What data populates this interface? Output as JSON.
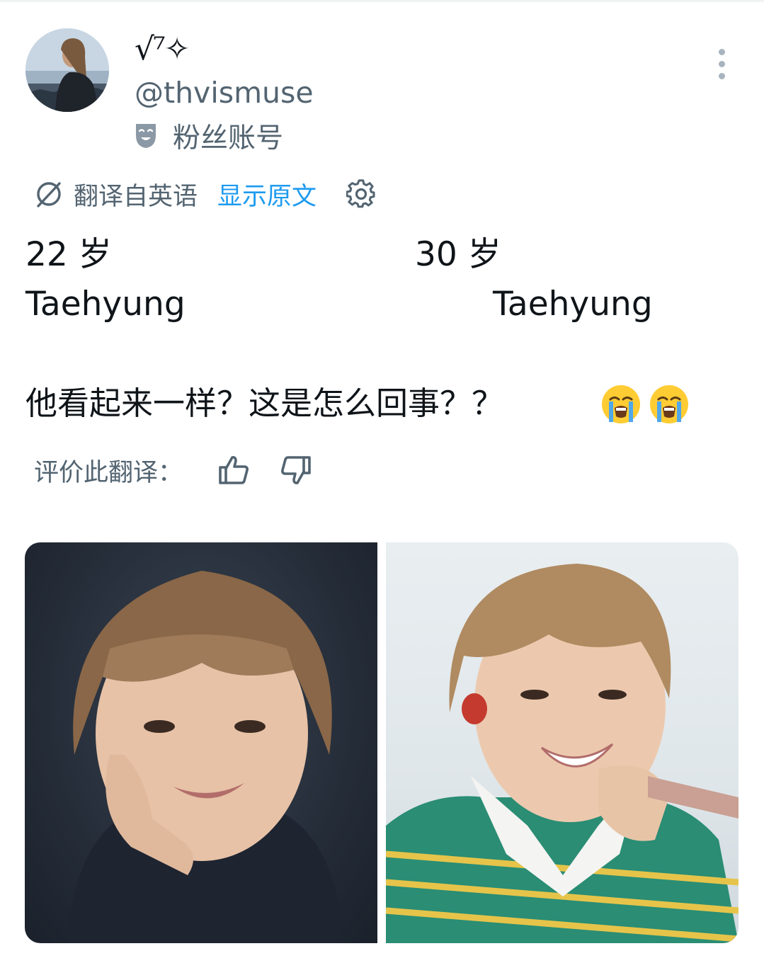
{
  "author": {
    "display_name": "√⁷✧",
    "handle": "@thvismuse",
    "account_label": "粉丝账号"
  },
  "translation_bar": {
    "label": "翻译自英语",
    "show_original": "显示原文"
  },
  "tweet": {
    "age_left": "22 岁",
    "age_right": "30 岁",
    "name_left": "Taehyung",
    "name_right": "Taehyung",
    "question": "他看起来一样？这是怎么回事？？",
    "emojis": [
      "loudly-crying-face",
      "loudly-crying-face"
    ]
  },
  "rating": {
    "label": "评价此翻译："
  },
  "colors": {
    "text_primary": "#0f1419",
    "text_secondary": "#536471",
    "link": "#1d9bf0"
  },
  "icons": [
    "fan-account-mask-icon",
    "more-options-icon",
    "translate-icon",
    "settings-gear-icon",
    "thumbs-up-icon",
    "thumbs-down-icon"
  ]
}
